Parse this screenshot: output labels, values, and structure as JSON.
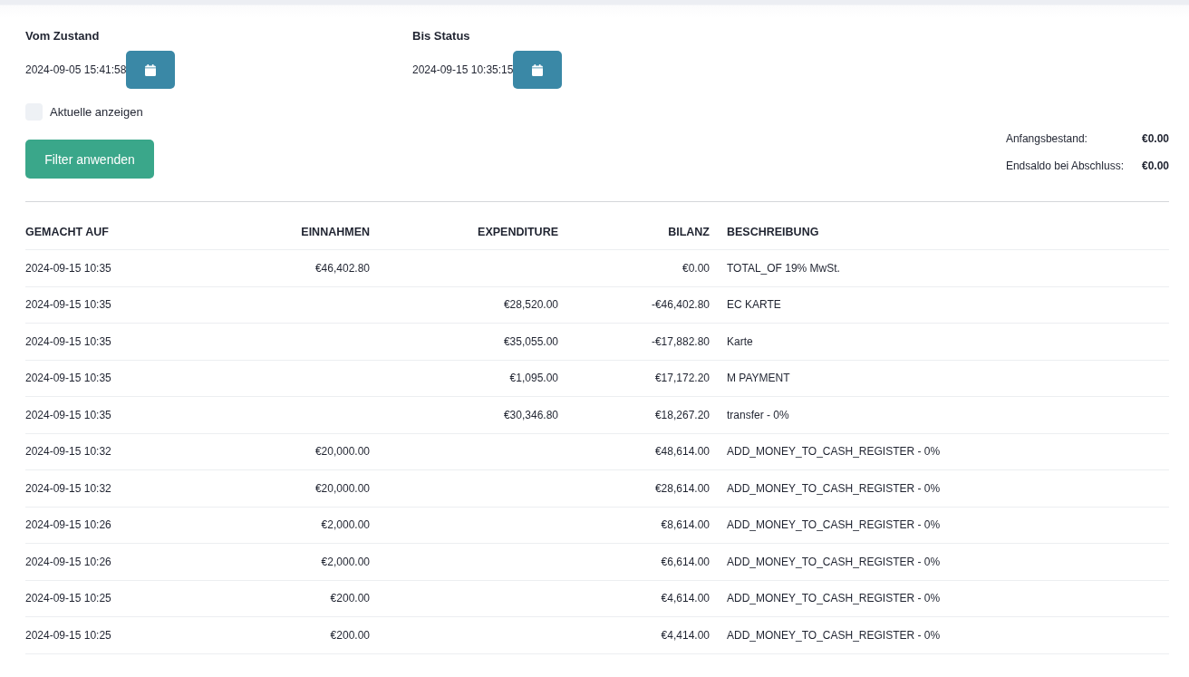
{
  "filters": [
    {
      "label": "Vom Zustand",
      "value": "2024-09-05 15:41:58"
    },
    {
      "label": "Bis Status",
      "value": "2024-09-15 10:35:15"
    }
  ],
  "show_current": {
    "label": "Aktuelle anzeigen",
    "checked": false
  },
  "apply_button": "Filter anwenden",
  "summary": [
    {
      "label": "Anfangsbestand:",
      "value": "€0.00"
    },
    {
      "label": "Endsaldo bei Abschluss:",
      "value": "€0.00"
    }
  ],
  "table": {
    "columns": [
      "GEMACHT AUF",
      "EINNAHMEN",
      "EXPENDITURE",
      "BILANZ",
      "BESCHREIBUNG"
    ],
    "rows": [
      [
        "2024-09-15 10:35",
        "€46,402.80",
        "",
        "€0.00",
        "TOTAL_OF 19% MwSt."
      ],
      [
        "2024-09-15 10:35",
        "",
        "€28,520.00",
        "-€46,402.80",
        "EC KARTE"
      ],
      [
        "2024-09-15 10:35",
        "",
        "€35,055.00",
        "-€17,882.80",
        "Karte"
      ],
      [
        "2024-09-15 10:35",
        "",
        "€1,095.00",
        "€17,172.20",
        "M PAYMENT"
      ],
      [
        "2024-09-15 10:35",
        "",
        "€30,346.80",
        "€18,267.20",
        "transfer - 0%"
      ],
      [
        "2024-09-15 10:32",
        "€20,000.00",
        "",
        "€48,614.00",
        "ADD_MONEY_TO_CASH_REGISTER - 0%"
      ],
      [
        "2024-09-15 10:32",
        "€20,000.00",
        "",
        "€28,614.00",
        "ADD_MONEY_TO_CASH_REGISTER - 0%"
      ],
      [
        "2024-09-15 10:26",
        "€2,000.00",
        "",
        "€8,614.00",
        "ADD_MONEY_TO_CASH_REGISTER - 0%"
      ],
      [
        "2024-09-15 10:26",
        "€2,000.00",
        "",
        "€6,614.00",
        "ADD_MONEY_TO_CASH_REGISTER - 0%"
      ],
      [
        "2024-09-15 10:25",
        "€200.00",
        "",
        "€4,614.00",
        "ADD_MONEY_TO_CASH_REGISTER - 0%"
      ],
      [
        "2024-09-15 10:25",
        "€200.00",
        "",
        "€4,414.00",
        "ADD_MONEY_TO_CASH_REGISTER - 0%"
      ]
    ]
  }
}
